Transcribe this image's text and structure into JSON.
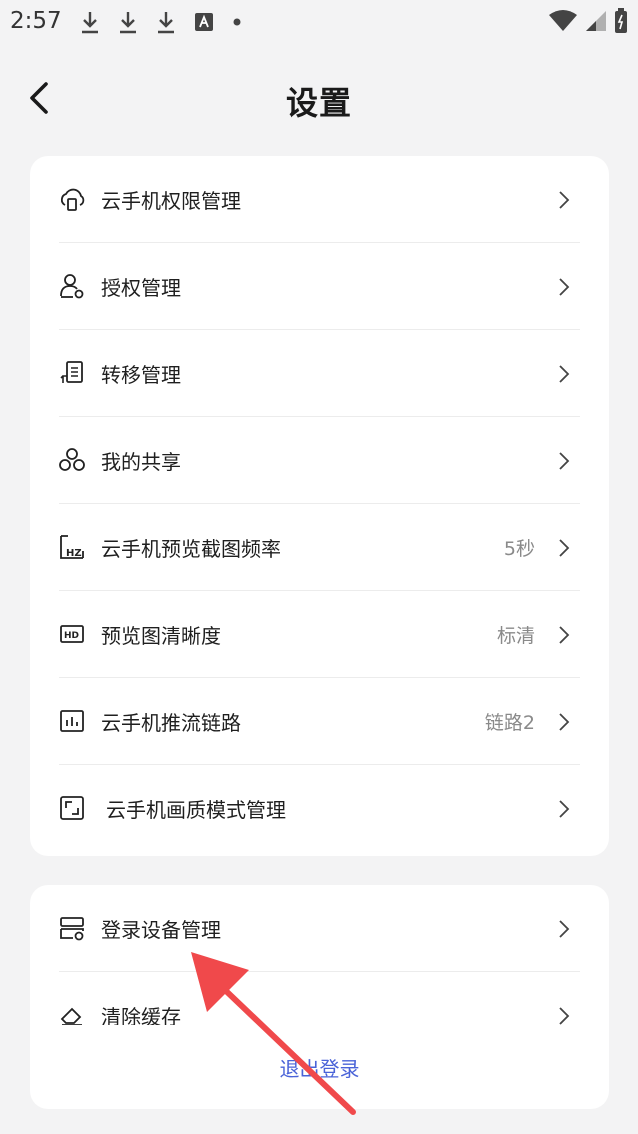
{
  "status_bar": {
    "time": "2:57"
  },
  "header": {
    "title": "设置"
  },
  "card1": {
    "items": [
      {
        "label": "云手机权限管理",
        "value": "",
        "icon": "cloud-phone-icon"
      },
      {
        "label": "授权管理",
        "value": "",
        "icon": "user-settings-icon"
      },
      {
        "label": "转移管理",
        "value": "",
        "icon": "transfer-icon"
      },
      {
        "label": "我的共享",
        "value": "",
        "icon": "share-icon"
      },
      {
        "label": "云手机预览截图频率",
        "value": "5秒",
        "icon": "hz-icon"
      },
      {
        "label": "预览图清晰度",
        "value": "标清",
        "icon": "hd-icon"
      },
      {
        "label": "云手机推流链路",
        "value": "链路2",
        "icon": "chart-icon"
      },
      {
        "label": "云手机画质模式管理",
        "value": "",
        "icon": "quality-icon"
      }
    ]
  },
  "card2": {
    "items": [
      {
        "label": "登录设备管理",
        "value": "",
        "icon": "device-icon"
      },
      {
        "label": "清除缓存",
        "value": "",
        "icon": "eraser-icon"
      }
    ]
  },
  "logout": {
    "label": "退出登录"
  },
  "colors": {
    "accent": "#4a63d8",
    "annotation_arrow": "#f0494b"
  }
}
